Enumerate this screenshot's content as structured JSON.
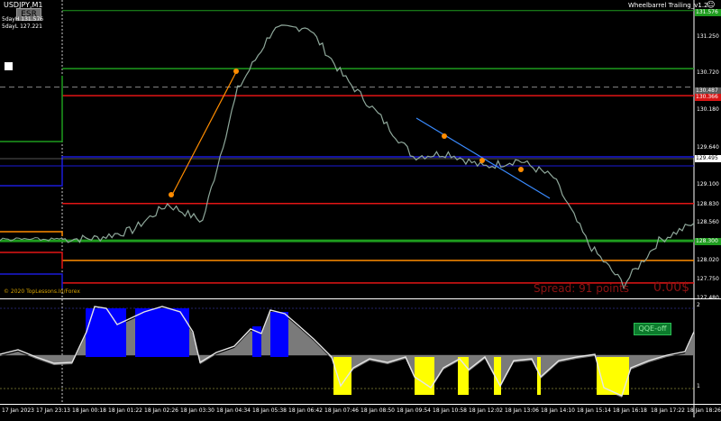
{
  "chart": {
    "symbol": "USDJPY,M1",
    "esr_button": "ESR",
    "day_high": "5dayH 131.576",
    "day_low": "5dayL 127.221",
    "ea_name": "Wheelbarrel Trailing_v1.2",
    "smiley": "☺",
    "copyright": "© 2020 TopLessons.In/Forex",
    "spread": "Spread: 91 points",
    "profit": "0.00$",
    "qqe_button": "QQE-off"
  },
  "price_labels": [
    {
      "text": "131.576",
      "bg": "#1e9c1e",
      "fg": "#ffffff"
    },
    {
      "text": "130.487",
      "bg": "#5a5a5a",
      "fg": "#ffffff"
    },
    {
      "text": "130.366",
      "bg": "#d61515",
      "fg": "#ffffff"
    },
    {
      "text": "129.495",
      "bg": "#ffffff",
      "fg": "#000000"
    },
    {
      "text": "128.300",
      "bg": "#1e9c1e",
      "fg": "#ffffff"
    }
  ],
  "price_ticks": [
    "131.250",
    "130.720",
    "130.180",
    "129.640",
    "129.100",
    "128.830",
    "128.560",
    "128.020",
    "127.750",
    "127.480"
  ],
  "indicator_ticks": [
    "2",
    "1"
  ],
  "time_ticks": [
    "17 Jan 2023",
    "17 Jan 23:13",
    "18 Jan 00:18",
    "18 Jan 01:22",
    "18 Jan 02:26",
    "18 Jan 03:30",
    "18 Jan 04:34",
    "18 Jan 05:38",
    "18 Jan 06:42",
    "18 Jan 07:46",
    "18 Jan 08:50",
    "18 Jan 09:54",
    "18 Jan 10:58",
    "18 Jan 12:02",
    "18 Jan 13:06",
    "18 Jan 14:10",
    "18 Jan 15:14",
    "18 Jan 16:18",
    "18 Jan 17:22",
    "18 Jan 18:26"
  ],
  "chart_data": {
    "type": "line",
    "title": "USDJPY,M1",
    "xlabel": "",
    "ylabel": "",
    "ylim": [
      127.48,
      131.65
    ],
    "x": [
      "17 Jan 23:13",
      "18 Jan 00:18",
      "18 Jan 01:22",
      "18 Jan 02:26",
      "18 Jan 03:30",
      "18 Jan 04:34",
      "18 Jan 05:38",
      "18 Jan 06:42",
      "18 Jan 07:46",
      "18 Jan 08:50",
      "18 Jan 09:54",
      "18 Jan 10:58",
      "18 Jan 12:02",
      "18 Jan 13:06",
      "18 Jan 14:10",
      "18 Jan 15:14",
      "18 Jan 16:18",
      "18 Jan 17:22",
      "18 Jan 18:26"
    ],
    "series": [
      {
        "values": [
          128.32,
          128.34,
          128.45,
          128.82,
          128.58,
          130.45,
          131.3,
          131.35,
          130.65,
          130.1,
          129.5,
          129.55,
          129.35,
          129.45,
          129.2,
          128.25,
          127.68,
          128.3,
          128.55
        ]
      }
    ],
    "horizontal_lines": [
      131.576,
      130.75,
      130.487,
      130.366,
      129.495,
      128.83,
      128.3,
      128.02,
      127.7
    ]
  },
  "colors": {
    "price": "#8fa89b",
    "green_level": "#1e9c1e",
    "red_level": "#e31515",
    "blue_level": "#1a1ad9",
    "orange_level": "#ff8c00",
    "qqe_blue": "#0000ff",
    "qqe_yellow": "#ffff00"
  }
}
